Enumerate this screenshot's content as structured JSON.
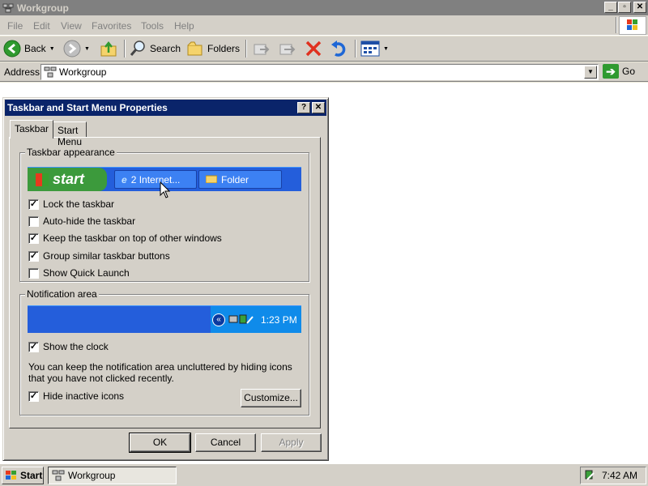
{
  "window": {
    "title": "Workgroup",
    "controls": {
      "min": "_",
      "max": "▫",
      "close": "✕"
    }
  },
  "menu": [
    "File",
    "Edit",
    "View",
    "Favorites",
    "Tools",
    "Help"
  ],
  "toolbar": {
    "back": "Back",
    "search": "Search",
    "folders": "Folders"
  },
  "address": {
    "label": "Address",
    "value": "Workgroup",
    "go": "Go"
  },
  "dialog": {
    "title": "Taskbar and Start Menu Properties",
    "help": "?",
    "close": "✕",
    "tabs": [
      "Taskbar",
      "Start Menu"
    ],
    "appearance": {
      "title": "Taskbar appearance",
      "preview": {
        "start": "start",
        "btn1": "2 Internet...",
        "btn2": "Folder"
      },
      "options": [
        {
          "label": "Lock the taskbar",
          "checked": true
        },
        {
          "label": "Auto-hide the taskbar",
          "checked": false
        },
        {
          "label": "Keep the taskbar on top of other windows",
          "checked": true
        },
        {
          "label": "Group similar taskbar buttons",
          "checked": true
        },
        {
          "label": "Show Quick Launch",
          "checked": false
        }
      ]
    },
    "notification": {
      "title": "Notification area",
      "preview_time": "1:23 PM",
      "show_clock": {
        "label": "Show the clock",
        "checked": true
      },
      "description": "You can keep the notification area uncluttered by hiding icons that you have not clicked recently.",
      "hide_inactive": {
        "label": "Hide inactive icons",
        "checked": true
      },
      "customize": "Customize..."
    },
    "buttons": {
      "ok": "OK",
      "cancel": "Cancel",
      "apply": "Apply"
    }
  },
  "taskbar": {
    "start": "Start",
    "task": "Workgroup",
    "time": "7:42 AM"
  }
}
